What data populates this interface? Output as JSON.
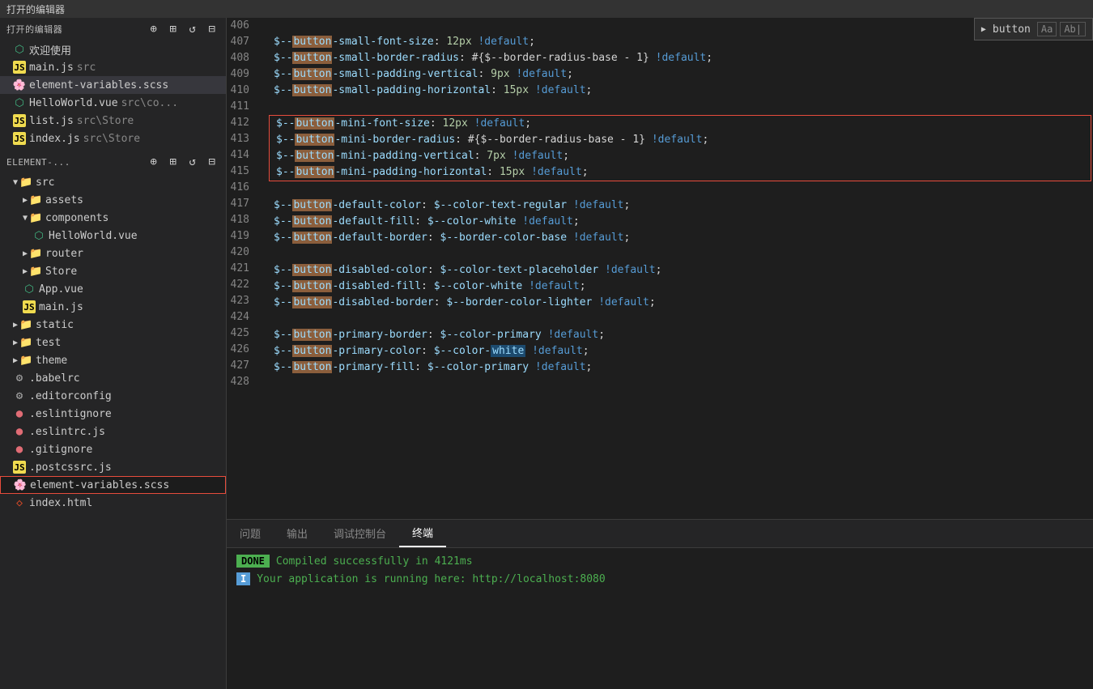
{
  "topbar": {
    "title": "打开的编辑器"
  },
  "sidebar": {
    "header_label": "ELEMENT-...",
    "open_editors": [
      {
        "id": "welcome",
        "label": "欢迎使用",
        "icon": "vue-icon",
        "type": "vue",
        "indent": 1
      },
      {
        "id": "main-js",
        "label": "main.js",
        "suffix": "src",
        "icon": "js-icon",
        "type": "js",
        "indent": 1
      },
      {
        "id": "element-variables",
        "label": "element-variables.scss",
        "icon": "scss-icon",
        "type": "scss",
        "indent": 1,
        "active": true
      },
      {
        "id": "helloworld-vue",
        "label": "HelloWorld.vue",
        "suffix": "src\\co...",
        "icon": "vue-icon",
        "type": "vue",
        "indent": 1
      },
      {
        "id": "list-js",
        "label": "list.js",
        "suffix": "src\\Store",
        "icon": "js-icon",
        "type": "js",
        "indent": 1
      },
      {
        "id": "index-js",
        "label": "index.js",
        "suffix": "src\\Store",
        "icon": "js-icon",
        "type": "js",
        "indent": 1
      }
    ],
    "tree": [
      {
        "id": "src-folder",
        "label": "src",
        "type": "folder",
        "expanded": true,
        "indent": 1
      },
      {
        "id": "assets-folder",
        "label": "assets",
        "type": "folder",
        "expanded": false,
        "indent": 2
      },
      {
        "id": "components-folder",
        "label": "components",
        "type": "folder",
        "expanded": true,
        "indent": 2
      },
      {
        "id": "helloworld-component",
        "label": "HelloWorld.vue",
        "type": "vue",
        "indent": 3
      },
      {
        "id": "router-folder",
        "label": "router",
        "type": "folder",
        "expanded": false,
        "indent": 2
      },
      {
        "id": "store-folder",
        "label": "Store",
        "type": "folder",
        "expanded": false,
        "indent": 2
      },
      {
        "id": "app-vue",
        "label": "App.vue",
        "type": "vue",
        "indent": 2
      },
      {
        "id": "main-js-tree",
        "label": "main.js",
        "type": "js",
        "indent": 2
      },
      {
        "id": "static-folder",
        "label": "static",
        "type": "folder",
        "expanded": false,
        "indent": 1
      },
      {
        "id": "test-folder",
        "label": "test",
        "type": "folder",
        "expanded": false,
        "indent": 1
      },
      {
        "id": "theme-folder",
        "label": "theme",
        "type": "folder",
        "expanded": false,
        "indent": 1
      },
      {
        "id": "babelrc",
        "label": ".babelrc",
        "type": "gear",
        "indent": 1
      },
      {
        "id": "editorconfig",
        "label": ".editorconfig",
        "type": "gear",
        "indent": 1
      },
      {
        "id": "eslintignore",
        "label": ".eslintignore",
        "type": "circle",
        "indent": 1
      },
      {
        "id": "eslintrc-js",
        "label": ".eslintrc.js",
        "type": "circle-js",
        "indent": 1
      },
      {
        "id": "gitignore",
        "label": ".gitignore",
        "type": "circle",
        "indent": 1
      },
      {
        "id": "postcssrc-js",
        "label": ".postcssrc.js",
        "type": "js",
        "indent": 1
      },
      {
        "id": "element-variables-bottom",
        "label": "element-variables.scss",
        "type": "scss",
        "highlighted": true,
        "indent": 1
      },
      {
        "id": "index-html",
        "label": "index.html",
        "type": "html",
        "indent": 1
      }
    ]
  },
  "search": {
    "term": "button",
    "option_aa": "Aa",
    "option_ab": "Ab|"
  },
  "editor": {
    "lines": [
      {
        "num": "406",
        "tokens": []
      },
      {
        "num": "407",
        "code": "$--<hl>button</hl>-small-font-size: 12px <def>!default</def>;"
      },
      {
        "num": "408",
        "code": "$--<hl>button</hl>-small-border-radius: #{$--border-radius-base - 1} <def>!default</def>;"
      },
      {
        "num": "409",
        "code": "$--<hl>button</hl>-small-padding-vertical: 9px <def>!default</def>;"
      },
      {
        "num": "410",
        "code": "$--<hl>button</hl>-small-padding-horizontal: 15px <def>!default</def>;"
      },
      {
        "num": "411",
        "tokens": []
      },
      {
        "num": "412",
        "code": "$--<hl>button</hl>-mini-font-size: 12px <def>!default</def>;",
        "block_start": true
      },
      {
        "num": "413",
        "code": "$--<hl>button</hl>-mini-border-radius: #{$--border-radius-base - 1} <def>!default</def>;",
        "block_mid": true
      },
      {
        "num": "414",
        "code": "$--<hl>button</hl>-mini-padding-vertical: 7px <def>!default</def>;",
        "block_mid": true
      },
      {
        "num": "415",
        "code": "$--<hl>button</hl>-mini-padding-horizontal: 15px <def>!default</def>;",
        "block_end": true
      },
      {
        "num": "416",
        "tokens": []
      },
      {
        "num": "417",
        "code": "$--<hl>button</hl>-default-color: $--color-text-regular <def>!default</def>;"
      },
      {
        "num": "418",
        "code": "$--<hl>button</hl>-default-fill: $--color-white <def>!default</def>;"
      },
      {
        "num": "419",
        "code": "$--<hl>button</hl>-default-border: $--border-color-base <def>!default</def>;"
      },
      {
        "num": "420",
        "tokens": []
      },
      {
        "num": "421",
        "code": "$--<hl>button</hl>-disabled-color: $--color-text-placeholder <def>!default</def>;"
      },
      {
        "num": "422",
        "code": "$--<hl>button</hl>-disabled-fill: $--color-white <def>!default</def>;"
      },
      {
        "num": "423",
        "code": "$--<hl>button</hl>-disabled-border: $--border-color-lighter <def>!default</def>;"
      },
      {
        "num": "424",
        "tokens": []
      },
      {
        "num": "425",
        "code": "$--<hl>button</hl>-primary-border: $--color-primary <def>!default</def>;"
      },
      {
        "num": "426",
        "code": "$--<hl>button</hl>-primary-color: $--color-<hlblue>white</hlblue> <def>!default</def>;"
      },
      {
        "num": "427",
        "code": "$--<hl>button</hl>-primary-fill: $--color-primary <def>!default</def>;"
      },
      {
        "num": "428",
        "tokens": []
      }
    ]
  },
  "panel": {
    "tabs": [
      "问题",
      "输出",
      "调试控制台",
      "终端"
    ],
    "active_tab": "终端",
    "done_label": "DONE",
    "done_message": "Compiled successfully in 4121ms",
    "prompt_label": "I",
    "running_message": "Your application is running here: http://localhost:8080"
  }
}
